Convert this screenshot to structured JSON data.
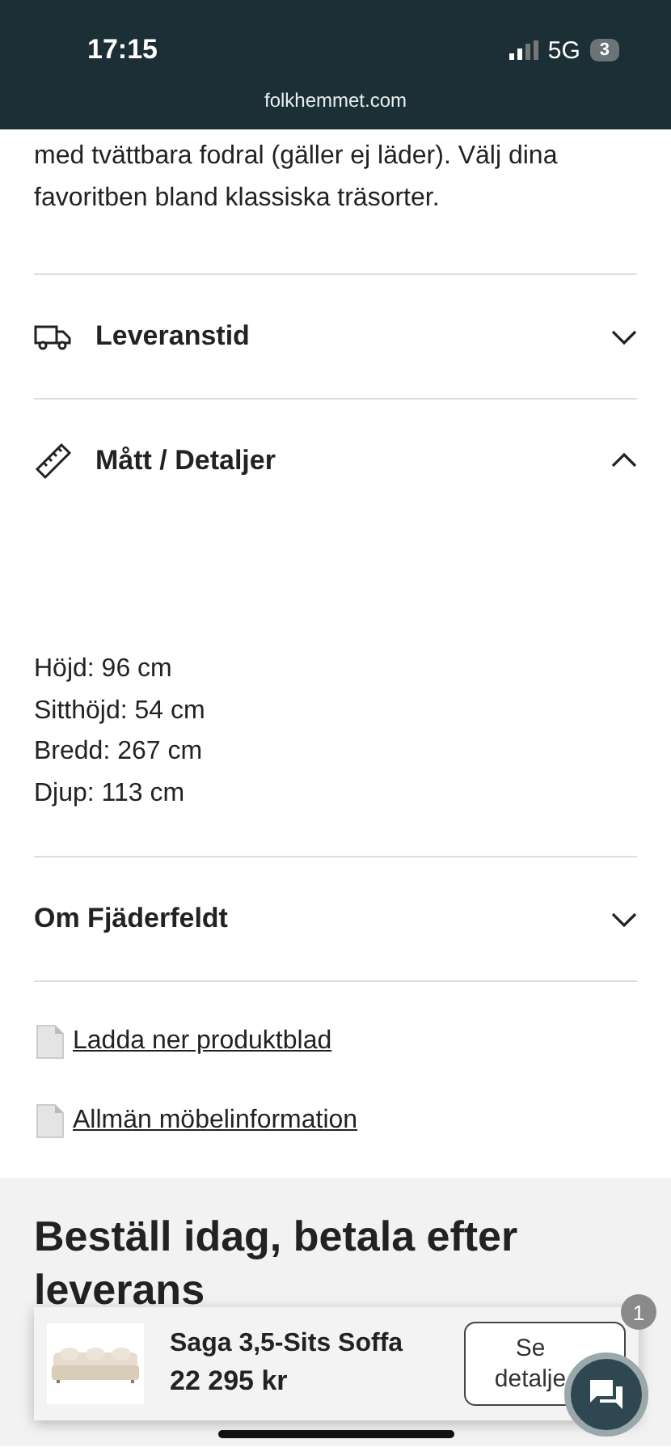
{
  "status_bar": {
    "time": "17:15",
    "network": "5G",
    "battery": "3"
  },
  "browser": {
    "url": "folkhemmet.com"
  },
  "intro_lines": [
    "med tvättbara fodral (gäller ej läder). Välj dina",
    "favoritben bland klassiska träsorter."
  ],
  "accordions": [
    {
      "kind": "truck",
      "title": "Leveranstid",
      "expanded": false
    },
    {
      "kind": "ruler",
      "title": "Mått / Detaljer",
      "expanded": true,
      "details": [
        "Höjd: 96 cm",
        "Sitthöjd: 54 cm",
        "Bredd: 267 cm",
        "Djup: 113 cm"
      ]
    },
    {
      "kind": "plain",
      "title": "Om Fjäderfeldt",
      "expanded": false
    }
  ],
  "links": [
    "Ladda ner produktblad",
    "Allmän möbelinformation"
  ],
  "promo": {
    "heading": "Beställ idag, betala efter leverans"
  },
  "sticky_bar": {
    "product": "Saga 3,5-Sits Soffa",
    "price": "22 295 kr",
    "button": "Se detalje"
  },
  "chat": {
    "badge": "1"
  }
}
